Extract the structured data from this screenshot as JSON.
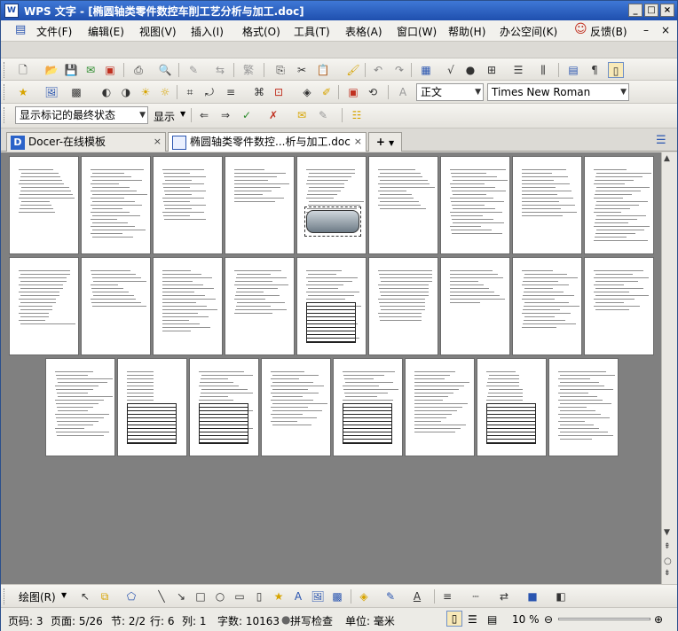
{
  "titlebar": {
    "app_icon_text": "W",
    "title": "WPS 文字 - [椭圆轴类零件数控车削工艺分析与加工.doc]"
  },
  "menu": {
    "items": [
      "文件(F)",
      "编辑(E)",
      "视图(V)",
      "插入(I)",
      "格式(O)",
      "工具(T)",
      "表格(A)",
      "窗口(W)",
      "帮助(H)",
      "办公空间(K)"
    ],
    "feedback": "反馈(B)"
  },
  "format_toolbar": {
    "style": "正文",
    "font": "Times New Roman"
  },
  "review_toolbar": {
    "markup_mode": "显示标记的最终状态",
    "show_label": "显示"
  },
  "tabs": [
    {
      "label": "Docer-在线模板",
      "icon_letter": "D"
    },
    {
      "label": "椭圆轴类零件数控...析与加工.doc"
    }
  ],
  "drawbar": {
    "draw_label": "绘图(R)"
  },
  "status": {
    "page_num": "页码: 3",
    "page_of": "页面: 5/26",
    "section": "节: 2/2",
    "row": "行: 6",
    "col": "列: 1",
    "word_count": "字数: 10163",
    "spellcheck": "拼写检查",
    "unit": "单位: 毫米",
    "zoom": "10 %"
  },
  "colors": {
    "titlebar": "#1f4fae",
    "doc_background": "#808080"
  }
}
